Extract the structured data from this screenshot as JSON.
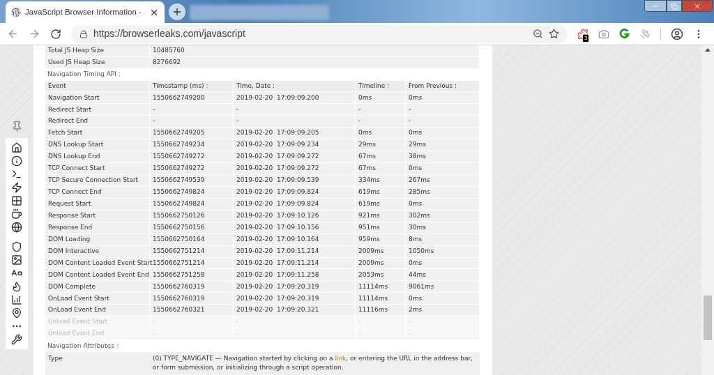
{
  "browser": {
    "tab": {
      "title": "JavaScript Browser Information -"
    },
    "url": "https://browserleaks.com/javascript",
    "extension_badge": "3"
  },
  "memory": [
    {
      "label": "Total JS Heap Size",
      "value": "10485760"
    },
    {
      "label": "Used JS Heap Size",
      "value": "8276692"
    }
  ],
  "timing": {
    "title": "Navigation Timing API :",
    "columns": [
      "Event",
      "Timestamp (ms) :",
      "Time, Date :",
      "Timeline :",
      "From Previous :"
    ],
    "rows": [
      {
        "event": "Navigation Start",
        "timestamp": "1550662749200",
        "time": "2019-02-20  17:09:09.200",
        "timeline": "0ms",
        "from_previous": "0ms",
        "dimmed": false
      },
      {
        "event": "Redirect Start",
        "timestamp": "-",
        "time": "-",
        "timeline": "-",
        "from_previous": "-",
        "dimmed": false
      },
      {
        "event": "Redirect End",
        "timestamp": "-",
        "time": "-",
        "timeline": "-",
        "from_previous": "-",
        "dimmed": false
      },
      {
        "event": "Fetch Start",
        "timestamp": "1550662749205",
        "time": "2019-02-20  17:09:09.205",
        "timeline": "0ms",
        "from_previous": "0ms",
        "dimmed": false
      },
      {
        "event": "DNS Lookup Start",
        "timestamp": "1550662749234",
        "time": "2019-02-20  17:09:09.234",
        "timeline": "29ms",
        "from_previous": "29ms",
        "dimmed": false
      },
      {
        "event": "DNS Lookup End",
        "timestamp": "1550662749272",
        "time": "2019-02-20  17:09:09.272",
        "timeline": "67ms",
        "from_previous": "38ms",
        "dimmed": false
      },
      {
        "event": "TCP Connect Start",
        "timestamp": "1550662749272",
        "time": "2019-02-20  17:09:09.272",
        "timeline": "67ms",
        "from_previous": "0ms",
        "dimmed": false
      },
      {
        "event": "TCP Secure Connection Start",
        "timestamp": "1550662749539",
        "time": "2019-02-20  17:09:09.539",
        "timeline": "334ms",
        "from_previous": "267ms",
        "dimmed": false
      },
      {
        "event": "TCP Connect End",
        "timestamp": "1550662749824",
        "time": "2019-02-20  17:09:09.824",
        "timeline": "619ms",
        "from_previous": "285ms",
        "dimmed": false
      },
      {
        "event": "Request Start",
        "timestamp": "1550662749824",
        "time": "2019-02-20  17:09:09.824",
        "timeline": "619ms",
        "from_previous": "0ms",
        "dimmed": false
      },
      {
        "event": "Response Start",
        "timestamp": "1550662750126",
        "time": "2019-02-20  17:09:10.126",
        "timeline": "921ms",
        "from_previous": "302ms",
        "dimmed": false
      },
      {
        "event": "Response End",
        "timestamp": "1550662750156",
        "time": "2019-02-20  17:09:10.156",
        "timeline": "951ms",
        "from_previous": "30ms",
        "dimmed": false
      },
      {
        "event": "DOM Loading",
        "timestamp": "1550662750164",
        "time": "2019-02-20  17:09:10.164",
        "timeline": "959ms",
        "from_previous": "8ms",
        "dimmed": false
      },
      {
        "event": "DOM Interactive",
        "timestamp": "1550662751214",
        "time": "2019-02-20  17:09:11.214",
        "timeline": "2009ms",
        "from_previous": "1050ms",
        "dimmed": false
      },
      {
        "event": "DOM Content Loaded Event Start",
        "timestamp": "1550662751214",
        "time": "2019-02-20  17:09:11.214",
        "timeline": "2009ms",
        "from_previous": "0ms",
        "dimmed": false
      },
      {
        "event": "DOM Content Loaded Event End",
        "timestamp": "1550662751258",
        "time": "2019-02-20  17:09:11.258",
        "timeline": "2053ms",
        "from_previous": "44ms",
        "dimmed": false
      },
      {
        "event": "DOM Complete",
        "timestamp": "1550662760319",
        "time": "2019-02-20  17:09:20.319",
        "timeline": "11114ms",
        "from_previous": "9061ms",
        "dimmed": false
      },
      {
        "event": "OnLoad Event Start",
        "timestamp": "1550662760319",
        "time": "2019-02-20  17:09:20.319",
        "timeline": "11114ms",
        "from_previous": "0ms",
        "dimmed": false
      },
      {
        "event": "OnLoad Event End",
        "timestamp": "1550662760321",
        "time": "2019-02-20  17:09:20.321",
        "timeline": "11116ms",
        "from_previous": "2ms",
        "dimmed": false
      },
      {
        "event": "Unload Event Start",
        "timestamp": "-",
        "time": "-",
        "timeline": "-",
        "from_previous": "-",
        "dimmed": true
      },
      {
        "event": "Unload Event End",
        "timestamp": "-",
        "time": "-",
        "timeline": "-",
        "from_previous": "-",
        "dimmed": true
      }
    ]
  },
  "attributes": {
    "title": "Navigation Attributes :",
    "rows": [
      {
        "label": "Type",
        "text_before": "(0) TYPE_NAVIGATE — Navigation started by clicking on a",
        "link": "link",
        "text_after": ", or entering the URL in the address bar, or form submission, or initializing through a script operation."
      }
    ]
  }
}
